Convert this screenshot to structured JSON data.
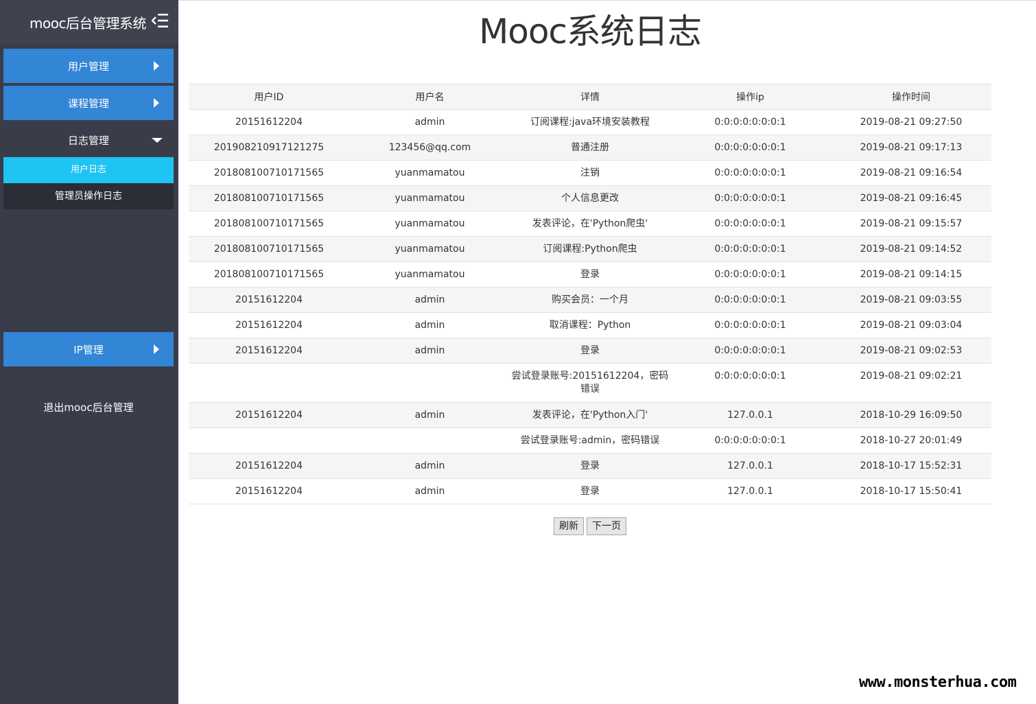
{
  "sidebar": {
    "title": "mooc后台管理系统",
    "menu_icon": "menu-fold-icon",
    "items": [
      {
        "label": "用户管理",
        "icon": "caret-right-icon"
      },
      {
        "label": "课程管理",
        "icon": "caret-right-icon"
      },
      {
        "label": "日志管理",
        "icon": "caret-down-icon",
        "expanded": true
      },
      {
        "label": "IP管理",
        "icon": "caret-right-icon"
      }
    ],
    "subitems": [
      {
        "label": "用户日志",
        "active": true
      },
      {
        "label": "管理员操作日志",
        "active": false
      }
    ],
    "logout": "退出mooc后台管理"
  },
  "main": {
    "title": "Mooc系统日志",
    "columns": [
      "用户ID",
      "用户名",
      "详情",
      "操作ip",
      "操作时间"
    ],
    "rows": [
      {
        "user_id": "20151612204",
        "username": "admin",
        "detail": "订阅课程:java环境安装教程",
        "ip": "0:0:0:0:0:0:0:1",
        "time": "2019-08-21 09:27:50"
      },
      {
        "user_id": "201908210917121275",
        "username": "123456@qq.com",
        "detail": "普通注册",
        "ip": "0:0:0:0:0:0:0:1",
        "time": "2019-08-21 09:17:13"
      },
      {
        "user_id": "201808100710171565",
        "username": "yuanmamatou",
        "detail": "注销",
        "ip": "0:0:0:0:0:0:0:1",
        "time": "2019-08-21 09:16:54"
      },
      {
        "user_id": "201808100710171565",
        "username": "yuanmamatou",
        "detail": "个人信息更改",
        "ip": "0:0:0:0:0:0:0:1",
        "time": "2019-08-21 09:16:45"
      },
      {
        "user_id": "201808100710171565",
        "username": "yuanmamatou",
        "detail": "发表评论，在'Python爬虫'",
        "ip": "0:0:0:0:0:0:0:1",
        "time": "2019-08-21 09:15:57"
      },
      {
        "user_id": "201808100710171565",
        "username": "yuanmamatou",
        "detail": "订阅课程:Python爬虫",
        "ip": "0:0:0:0:0:0:0:1",
        "time": "2019-08-21 09:14:52"
      },
      {
        "user_id": "201808100710171565",
        "username": "yuanmamatou",
        "detail": "登录",
        "ip": "0:0:0:0:0:0:0:1",
        "time": "2019-08-21 09:14:15"
      },
      {
        "user_id": "20151612204",
        "username": "admin",
        "detail": "购买会员：一个月",
        "ip": "0:0:0:0:0:0:0:1",
        "time": "2019-08-21 09:03:55"
      },
      {
        "user_id": "20151612204",
        "username": "admin",
        "detail": "取消课程：Python",
        "ip": "0:0:0:0:0:0:0:1",
        "time": "2019-08-21 09:03:04"
      },
      {
        "user_id": "20151612204",
        "username": "admin",
        "detail": "登录",
        "ip": "0:0:0:0:0:0:0:1",
        "time": "2019-08-21 09:02:53"
      },
      {
        "user_id": "",
        "username": "",
        "detail": "尝试登录账号:20151612204，密码错误",
        "ip": "0:0:0:0:0:0:0:1",
        "time": "2019-08-21 09:02:21",
        "tall": true
      },
      {
        "user_id": "20151612204",
        "username": "admin",
        "detail": "发表评论，在'Python入门'",
        "ip": "127.0.0.1",
        "time": "2018-10-29 16:09:50"
      },
      {
        "user_id": "",
        "username": "",
        "detail": "尝试登录账号:admin，密码错误",
        "ip": "0:0:0:0:0:0:0:1",
        "time": "2018-10-27 20:01:49"
      },
      {
        "user_id": "20151612204",
        "username": "admin",
        "detail": "登录",
        "ip": "127.0.0.1",
        "time": "2018-10-17 15:52:31"
      },
      {
        "user_id": "20151612204",
        "username": "admin",
        "detail": "登录",
        "ip": "127.0.0.1",
        "time": "2018-10-17 15:50:41"
      }
    ],
    "refresh_label": "刷新",
    "next_label": "下一页"
  },
  "watermark": "www.monsterhua.com",
  "colors": {
    "sidebar_bg": "#393d49",
    "menu_blue": "#3385d6",
    "active_cyan": "#1ec4f2"
  }
}
